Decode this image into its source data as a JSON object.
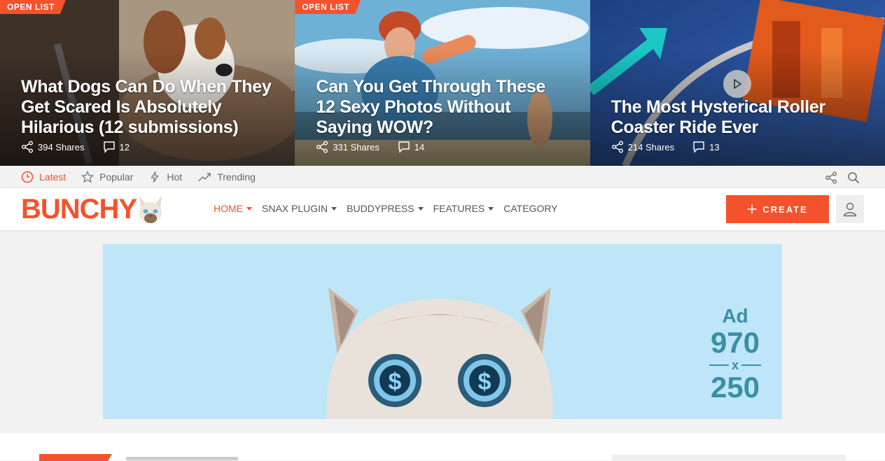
{
  "hero": [
    {
      "badge": "OPEN LIST",
      "title": "What Dogs Can Do When They Get Scared Is Absolutely Hilarious (12 submissions)",
      "shares": "394 Shares",
      "comments": "12",
      "has_badge": true
    },
    {
      "badge": "OPEN LIST",
      "title": "Can You Get Through These 12 Sexy Photos Without Saying WOW?",
      "shares": "331 Shares",
      "comments": "14",
      "has_badge": true
    },
    {
      "badge": "",
      "title": "The Most Hysterical Roller Coaster Ride Ever",
      "shares": "214 Shares",
      "comments": "13",
      "has_badge": false
    }
  ],
  "subnav": {
    "items": [
      {
        "label": "Latest",
        "icon": "clock-icon",
        "active": true
      },
      {
        "label": "Popular",
        "icon": "star-icon",
        "active": false
      },
      {
        "label": "Hot",
        "icon": "lightning-icon",
        "active": false
      },
      {
        "label": "Trending",
        "icon": "trending-icon",
        "active": false
      }
    ]
  },
  "header": {
    "logo": "BUNCHY",
    "nav": [
      {
        "label": "HOME",
        "dropdown": true,
        "active": true
      },
      {
        "label": "SNAX PLUGIN",
        "dropdown": true,
        "active": false
      },
      {
        "label": "BUDDYPRESS",
        "dropdown": true,
        "active": false
      },
      {
        "label": "FEATURES",
        "dropdown": true,
        "active": false
      },
      {
        "label": "CATEGORY",
        "dropdown": false,
        "active": false
      }
    ],
    "create_label": "CREATE"
  },
  "ad": {
    "line1": "Ad",
    "line2": "970",
    "line3": "x",
    "line4": "250"
  },
  "colors": {
    "accent": "#f4522d",
    "ad_bg": "#bee6f8",
    "ad_text": "#3a8fa3"
  }
}
